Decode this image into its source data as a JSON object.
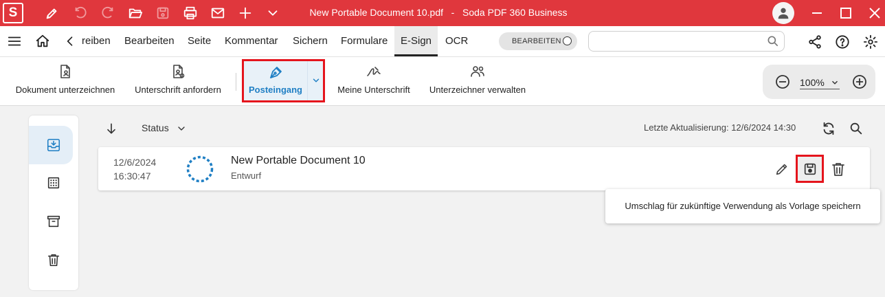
{
  "title_bar": {
    "logo_letter": "S",
    "document_name": "New Portable Document 10.pdf",
    "separator": "-",
    "app_name": "Soda PDF 360 Business"
  },
  "menu": {
    "tabs": [
      {
        "label": "reiben"
      },
      {
        "label": "Bearbeiten"
      },
      {
        "label": "Seite"
      },
      {
        "label": "Kommentar"
      },
      {
        "label": "Sichern"
      },
      {
        "label": "Formulare"
      },
      {
        "label": "E-Sign",
        "active": true
      },
      {
        "label": "OCR"
      }
    ],
    "mode_toggle_label": "BEARBEITEN",
    "search_placeholder": ""
  },
  "ribbon": {
    "buttons": [
      {
        "label": "Dokument unterzeichnen",
        "icon": "sign-document-icon"
      },
      {
        "label": "Unterschrift anfordern",
        "icon": "request-signature-icon"
      },
      {
        "label": "Posteingang",
        "icon": "pen-nib-icon",
        "selected": true
      },
      {
        "label": "Meine Unterschrift",
        "icon": "signature-icon"
      },
      {
        "label": "Unterzeichner verwalten",
        "icon": "people-icon"
      }
    ],
    "zoom": "100%"
  },
  "list": {
    "sort_label": "Status",
    "last_update_label": "Letzte Aktualisierung:",
    "last_update_value": "12/6/2024 14:30",
    "rows": [
      {
        "date": "12/6/2024",
        "time": "16:30:47",
        "name": "New Portable Document 10",
        "status": "Entwurf"
      }
    ]
  },
  "tooltip": "Umschlag für zukünftige Verwendung als Vorlage speichern",
  "colors": {
    "title_bar": "#e0373d",
    "highlight_red": "#e5141c",
    "accent_blue": "#1f7fc4"
  }
}
